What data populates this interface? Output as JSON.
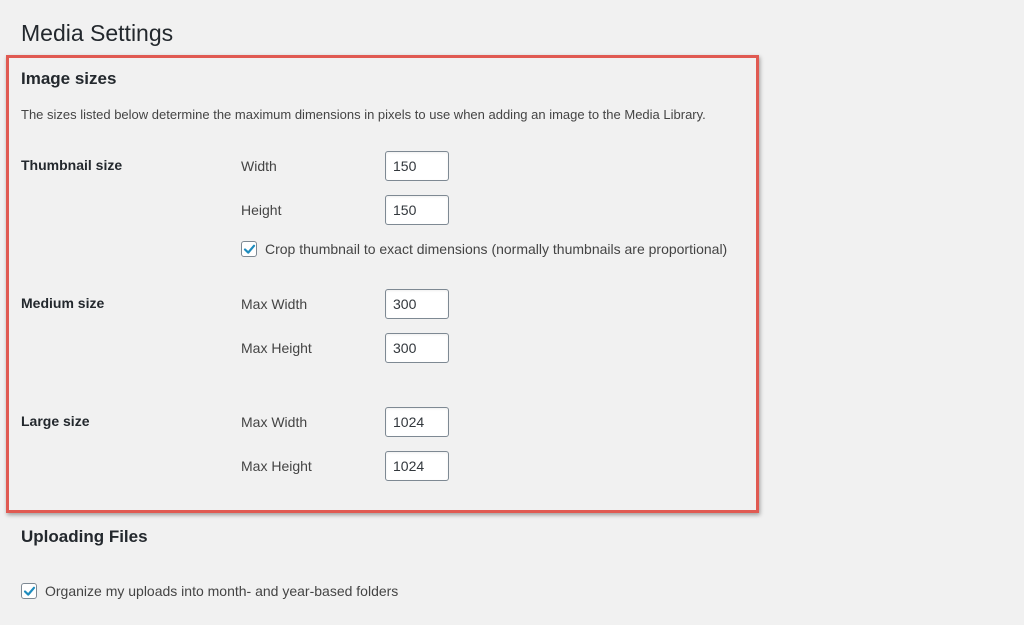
{
  "page": {
    "title": "Media Settings"
  },
  "image_sizes": {
    "heading": "Image sizes",
    "description": "The sizes listed below determine the maximum dimensions in pixels to use when adding an image to the Media Library.",
    "thumbnail": {
      "label": "Thumbnail size",
      "width_label": "Width",
      "width_value": "150",
      "height_label": "Height",
      "height_value": "150",
      "crop_checked": true,
      "crop_label": "Crop thumbnail to exact dimensions (normally thumbnails are proportional)"
    },
    "medium": {
      "label": "Medium size",
      "max_width_label": "Max Width",
      "max_width_value": "300",
      "max_height_label": "Max Height",
      "max_height_value": "300"
    },
    "large": {
      "label": "Large size",
      "max_width_label": "Max Width",
      "max_width_value": "1024",
      "max_height_label": "Max Height",
      "max_height_value": "1024"
    }
  },
  "uploading": {
    "heading": "Uploading Files",
    "organize_checked": true,
    "organize_label": "Organize my uploads into month- and year-based folders"
  },
  "colors": {
    "highlight_border": "#e05a52",
    "checkmark": "#1e8cbe",
    "background": "#f1f1f1"
  }
}
